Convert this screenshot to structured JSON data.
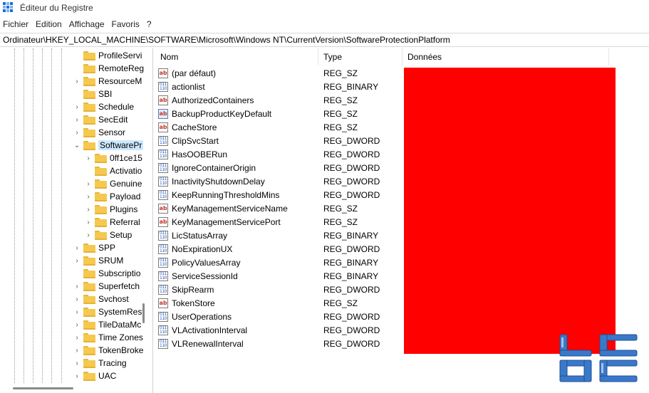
{
  "window": {
    "title": "Éditeur du Registre"
  },
  "menu": [
    "Fichier",
    "Edition",
    "Affichage",
    "Favoris",
    "?"
  ],
  "address": "Ordinateur\\HKEY_LOCAL_MACHINE\\SOFTWARE\\Microsoft\\Windows NT\\CurrentVersion\\SoftwareProtectionPlatform",
  "tree": [
    {
      "label": "ProfileServi",
      "chevron": "",
      "selected": false
    },
    {
      "label": "RemoteReg",
      "chevron": "",
      "selected": false
    },
    {
      "label": "ResourceM",
      "chevron": "›",
      "selected": false
    },
    {
      "label": "SBI",
      "chevron": "",
      "selected": false
    },
    {
      "label": "Schedule",
      "chevron": "›",
      "selected": false
    },
    {
      "label": "SecEdit",
      "chevron": "›",
      "selected": false
    },
    {
      "label": "Sensor",
      "chevron": "›",
      "selected": false
    },
    {
      "label": "SoftwarePr",
      "chevron": "⌄",
      "selected": true
    },
    {
      "label": "0ff1ce15",
      "chevron": "›",
      "selected": false
    },
    {
      "label": "Activatio",
      "chevron": "",
      "selected": false
    },
    {
      "label": "Genuine",
      "chevron": "›",
      "selected": false
    },
    {
      "label": "Payload",
      "chevron": "›",
      "selected": false
    },
    {
      "label": "Plugins",
      "chevron": "›",
      "selected": false
    },
    {
      "label": "Referral",
      "chevron": "›",
      "selected": false
    },
    {
      "label": "Setup",
      "chevron": "›",
      "selected": false
    },
    {
      "label": "SPP",
      "chevron": "›",
      "selected": false
    },
    {
      "label": "SRUM",
      "chevron": "›",
      "selected": false
    },
    {
      "label": "Subscriptio",
      "chevron": "",
      "selected": false
    },
    {
      "label": "Superfetch",
      "chevron": "›",
      "selected": false
    },
    {
      "label": "Svchost",
      "chevron": "›",
      "selected": false
    },
    {
      "label": "SystemRest",
      "chevron": "›",
      "selected": false
    },
    {
      "label": "TileDataMc",
      "chevron": "›",
      "selected": false
    },
    {
      "label": "Time Zones",
      "chevron": "›",
      "selected": false
    },
    {
      "label": "TokenBroke",
      "chevron": "›",
      "selected": false
    },
    {
      "label": "Tracing",
      "chevron": "›",
      "selected": false
    },
    {
      "label": "UAC",
      "chevron": "›",
      "selected": false
    }
  ],
  "columns": {
    "name": "Nom",
    "type": "Type",
    "data": "Données"
  },
  "values": [
    {
      "name": "(par défaut)",
      "type": "REG_SZ",
      "icon": "ab"
    },
    {
      "name": "actionlist",
      "type": "REG_BINARY",
      "icon": "bin"
    },
    {
      "name": "AuthorizedContainers",
      "type": "REG_SZ",
      "icon": "ab"
    },
    {
      "name": "BackupProductKeyDefault",
      "type": "REG_SZ",
      "icon": "ab-selected"
    },
    {
      "name": "CacheStore",
      "type": "REG_SZ",
      "icon": "ab"
    },
    {
      "name": "ClipSvcStart",
      "type": "REG_DWORD",
      "icon": "bin"
    },
    {
      "name": "HasOOBERun",
      "type": "REG_DWORD",
      "icon": "bin"
    },
    {
      "name": "IgnoreContainerOrigin",
      "type": "REG_DWORD",
      "icon": "bin"
    },
    {
      "name": "InactivityShutdownDelay",
      "type": "REG_DWORD",
      "icon": "bin"
    },
    {
      "name": "KeepRunningThresholdMins",
      "type": "REG_DWORD",
      "icon": "bin"
    },
    {
      "name": "KeyManagementServiceName",
      "type": "REG_SZ",
      "icon": "ab"
    },
    {
      "name": "KeyManagementServicePort",
      "type": "REG_SZ",
      "icon": "ab"
    },
    {
      "name": "LicStatusArray",
      "type": "REG_BINARY",
      "icon": "bin"
    },
    {
      "name": "NoExpirationUX",
      "type": "REG_DWORD",
      "icon": "bin"
    },
    {
      "name": "PolicyValuesArray",
      "type": "REG_BINARY",
      "icon": "bin"
    },
    {
      "name": "ServiceSessionId",
      "type": "REG_BINARY",
      "icon": "bin"
    },
    {
      "name": "SkipRearm",
      "type": "REG_DWORD",
      "icon": "bin"
    },
    {
      "name": "TokenStore",
      "type": "REG_SZ",
      "icon": "ab"
    },
    {
      "name": "UserOperations",
      "type": "REG_DWORD",
      "icon": "bin"
    },
    {
      "name": "VLActivationInterval",
      "type": "REG_DWORD",
      "icon": "bin"
    },
    {
      "name": "VLRenewalInterval",
      "type": "REG_DWORD",
      "icon": "bin"
    }
  ],
  "colors": {
    "redaction": "#ff0000",
    "selection": "#cce8ff",
    "folder": "#f5c84f",
    "logo": "#3a78c9"
  }
}
